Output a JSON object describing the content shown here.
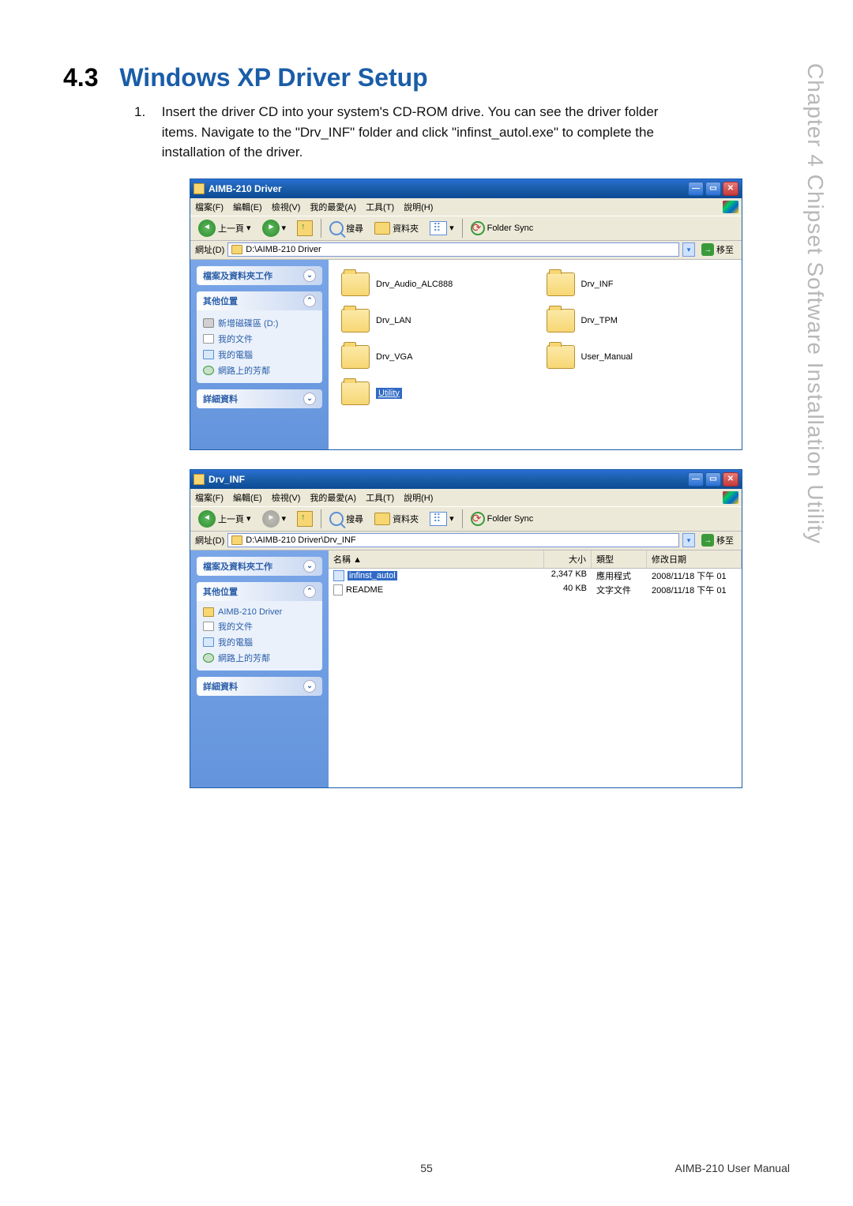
{
  "side_text": "Chapter 4 Chipset Software Installation Utility",
  "section": {
    "num": "4.3",
    "title": "Windows XP Driver Setup"
  },
  "instruction": {
    "num": "1.",
    "text": "Insert the driver CD into your system's CD-ROM drive. You can see the driver folder items. Navigate to the \"Drv_INF\" folder and click \"infinst_autol.exe\" to complete the installation of the driver."
  },
  "window1": {
    "title": "AIMB-210 Driver",
    "menu": [
      "檔案(F)",
      "編輯(E)",
      "檢視(V)",
      "我的最愛(A)",
      "工具(T)",
      "說明(H)"
    ],
    "toolbar": {
      "back": "上一頁",
      "search": "搜尋",
      "folders": "資料夾",
      "sync": "Folder Sync"
    },
    "address_label": "網址(D)",
    "address_path": "D:\\AIMB-210 Driver",
    "go": "移至",
    "sidebar": {
      "panel1": "檔案及資料夾工作",
      "panel2": "其他位置",
      "links2": [
        {
          "label": "新增磁碟區 (D:)",
          "icon": "drive"
        },
        {
          "label": "我的文件",
          "icon": "doc"
        },
        {
          "label": "我的電腦",
          "icon": "computer"
        },
        {
          "label": "網路上的芳鄰",
          "icon": "network"
        }
      ],
      "panel3": "詳細資料"
    },
    "folders": [
      {
        "label": "Drv_Audio_ALC888"
      },
      {
        "label": "Drv_INF"
      },
      {
        "label": "Drv_LAN"
      },
      {
        "label": "Drv_TPM"
      },
      {
        "label": "Drv_VGA"
      },
      {
        "label": "User_Manual"
      },
      {
        "label": "Utility",
        "selected": true
      }
    ]
  },
  "window2": {
    "title": "Drv_INF",
    "menu": [
      "檔案(F)",
      "編輯(E)",
      "檢視(V)",
      "我的最愛(A)",
      "工具(T)",
      "說明(H)"
    ],
    "toolbar": {
      "back": "上一頁",
      "search": "搜尋",
      "folders": "資料夾",
      "sync": "Folder Sync"
    },
    "address_label": "網址(D)",
    "address_path": "D:\\AIMB-210 Driver\\Drv_INF",
    "go": "移至",
    "sidebar": {
      "panel1": "檔案及資料夾工作",
      "panel2": "其他位置",
      "links2": [
        {
          "label": "AIMB-210 Driver",
          "icon": "folder"
        },
        {
          "label": "我的文件",
          "icon": "doc"
        },
        {
          "label": "我的電腦",
          "icon": "computer"
        },
        {
          "label": "網路上的芳鄰",
          "icon": "network"
        }
      ],
      "panel3": "詳細資料"
    },
    "columns": {
      "name": "名稱",
      "size": "大小",
      "type": "類型",
      "date": "修改日期"
    },
    "sort_indicator": "▲",
    "files": [
      {
        "name": "infinst_autol",
        "size": "2,347 KB",
        "type": "應用程式",
        "date": "2008/11/18 下午 01",
        "icon": "exe",
        "selected": true
      },
      {
        "name": "README",
        "size": "40 KB",
        "type": "文字文件",
        "date": "2008/11/18 下午 01",
        "icon": "txt"
      }
    ]
  },
  "footer": {
    "page": "55",
    "doc": "AIMB-210 User Manual"
  }
}
